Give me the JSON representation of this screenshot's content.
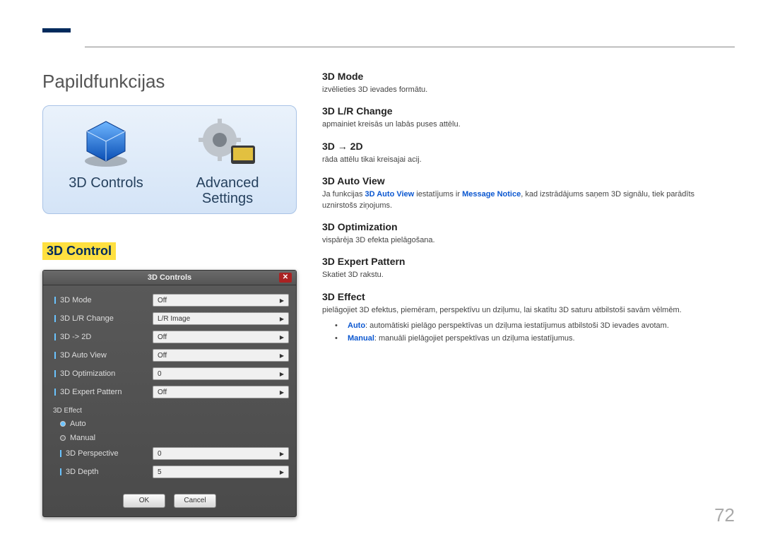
{
  "page": {
    "title": "Papildfunkcijas",
    "number": "72"
  },
  "icon_panel": {
    "tile1": {
      "label": "3D Controls",
      "icon": "cube-3d-icon"
    },
    "tile2": {
      "label": "Advanced Settings",
      "icon": "gear-thumb-icon"
    }
  },
  "section_heading": "3D Control",
  "dialog": {
    "title": "3D Controls",
    "close": "✕",
    "rows": [
      {
        "label": "3D Mode",
        "value": "Off"
      },
      {
        "label": "3D L/R Change",
        "value": "L/R Image"
      },
      {
        "label": "3D -> 2D",
        "value": "Off"
      },
      {
        "label": "3D Auto View",
        "value": "Off"
      },
      {
        "label": "3D Optimization",
        "value": "0",
        "spinner": true
      },
      {
        "label": "3D Expert Pattern",
        "value": "Off"
      }
    ],
    "effect_group": {
      "label": "3D Effect",
      "options": [
        {
          "label": "Auto",
          "selected": true
        },
        {
          "label": "Manual",
          "selected": false
        }
      ],
      "subrows": [
        {
          "label": "3D Perspective",
          "value": "0",
          "spinner": true
        },
        {
          "label": "3D Depth",
          "value": "5",
          "spinner": true
        }
      ]
    },
    "buttons": {
      "ok": "OK",
      "cancel": "Cancel"
    }
  },
  "right": {
    "s1": {
      "h": "3D Mode",
      "p": "izvēlieties 3D ievades formātu."
    },
    "s2": {
      "h": "3D L/R Change",
      "p": "apmainiet kreisās un labās puses attēlu."
    },
    "s3": {
      "h": "3D → 2D",
      "p": "rāda attēlu tikai kreisajai acij."
    },
    "s4": {
      "h": "3D Auto View",
      "p_pre": "Ja funkcijas ",
      "p_b1": "3D Auto View",
      "p_mid": " iestatījums ir ",
      "p_b2": "Message Notice",
      "p_post": ", kad izstrādājums saņem 3D signālu, tiek parādīts uznirstošs ziņojums."
    },
    "s5": {
      "h": "3D Optimization",
      "p": "vispārēja 3D efekta pielāgošana."
    },
    "s6": {
      "h": "3D Expert Pattern",
      "p": "Skatiet 3D rakstu."
    },
    "s7": {
      "h": "3D Effect",
      "p": "pielāgojiet 3D efektus, piemēram, perspektīvu un dziļumu, lai skatītu 3D saturu atbilstoši savām vēlmēm.",
      "b1_key": "Auto",
      "b1_txt": ": automātiski pielāgo perspektīvas un dziļuma iestatījumus atbilstoši 3D ievades avotam.",
      "b2_key": "Manual",
      "b2_txt": ": manuāli pielāgojiet perspektīvas un dziļuma iestatījumus."
    }
  }
}
